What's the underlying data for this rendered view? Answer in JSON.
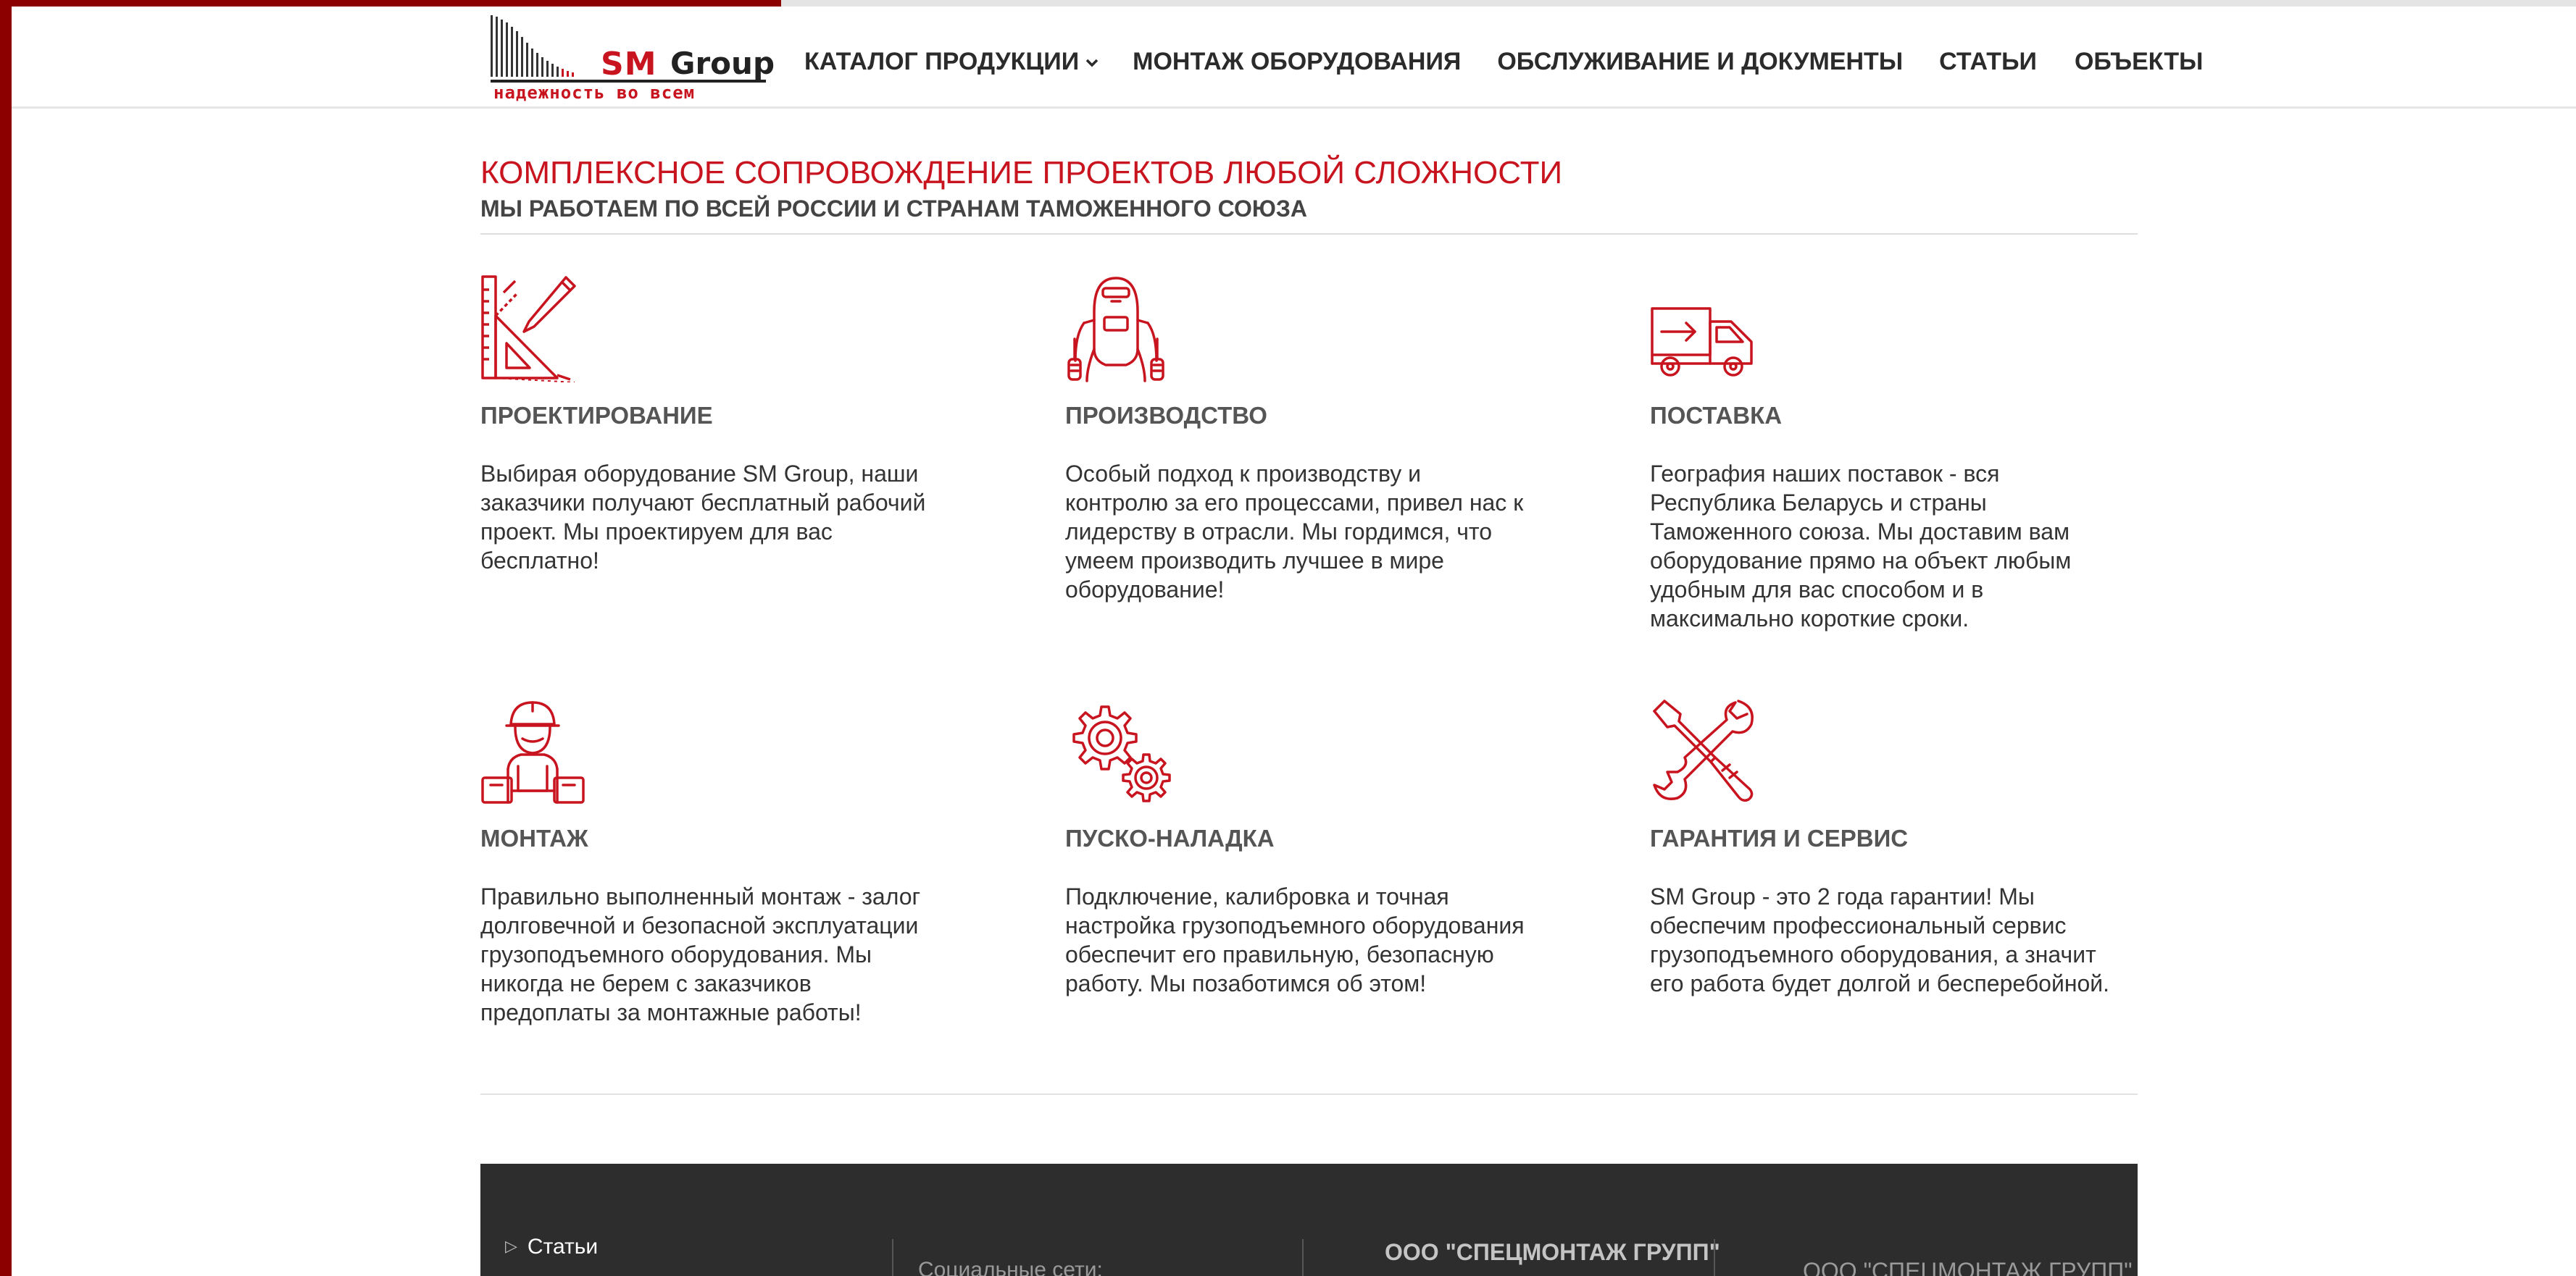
{
  "colors": {
    "accent": "#c8141e",
    "frame": "#8c0000",
    "text": "#333333",
    "footer_bg": "#2d2d2d"
  },
  "header": {
    "logo": {
      "brand_sm": "SM",
      "brand_group": "Group",
      "tagline": "надежность во всем"
    },
    "nav": [
      {
        "label": "КАТАЛОГ ПРОДУКЦИИ",
        "icon": "chevron-down-icon"
      },
      {
        "label": "МОНТАЖ ОБОРУДОВАНИЯ"
      },
      {
        "label": "ОБСЛУЖИВАНИЕ И ДОКУМЕНТЫ"
      },
      {
        "label": "СТАТЬИ"
      },
      {
        "label": "ОБЪЕКТЫ"
      }
    ]
  },
  "main": {
    "title": "КОМПЛЕКСНОЕ СОПРОВОЖДЕНИЕ ПРОЕКТОВ ЛЮБОЙ СЛОЖНОСТИ",
    "subtitle": "МЫ РАБОТАЕМ ПО ВСЕЙ РОССИИ И СТРАНАМ ТАМОЖЕННОГО СОЮЗА",
    "features": [
      {
        "icon": "drafting-tools-icon",
        "title": "ПРОЕКТИРОВАНИЕ",
        "lines": [
          "Выбирая оборудование SM Group, наши",
          "заказчики получают бесплатный рабочий",
          "проект. Мы проектируем для вас",
          "бесплатно!"
        ]
      },
      {
        "icon": "welder-icon",
        "title": "ПРОИЗВОДСТВО",
        "lines": [
          "Особый подход к производству и",
          "контролю за его процессами, привел нас к",
          "лидерству в отрасли. Мы гордимся, что",
          "умеем производить лучшее в мире",
          "оборудование!"
        ]
      },
      {
        "icon": "delivery-truck-icon",
        "title": "ПОСТАВКА",
        "lines": [
          "География наших поставок - вся",
          "Республика Беларусь и страны",
          "Таможенного союза. Мы доставим вам",
          "оборудование прямо на объект любым",
          "удобным для вас способом и в",
          "максимально короткие сроки."
        ]
      },
      {
        "icon": "installer-worker-icon",
        "title": "МОНТАЖ",
        "lines": [
          "Правильно выполненный монтаж - залог",
          "долговечной и безопасной эксплуатации",
          "грузоподъемного оборудования. Мы",
          "никогда не берем с заказчиков",
          "предоплаты за монтажные работы!"
        ]
      },
      {
        "icon": "gears-icon",
        "title": "ПУСКО-НАЛАДКА",
        "lines": [
          "Подключение, калибровка и точная",
          "настройка грузоподъемного оборудования",
          "обеспечит его правильную, безопасную",
          "работу. Мы позаботимся об этом!"
        ]
      },
      {
        "icon": "wrench-screwdriver-icon",
        "title": "ГАРАНТИЯ И СЕРВИС",
        "lines": [
          "SM Group - это 2 года гарантии! Мы",
          "обеспечим профессиональный сервис",
          "грузоподъемного оборудования, а значит",
          "его работа будет долгой и бесперебойной."
        ]
      }
    ]
  },
  "footer": {
    "link": "Статьи",
    "social_label": "Социальные сети:",
    "company_1": "ООО \"СПЕЦМОНТАЖ ГРУПП\"",
    "company_2": "ООО \"СПЕЦМОНТАЖ ГРУПП\""
  }
}
